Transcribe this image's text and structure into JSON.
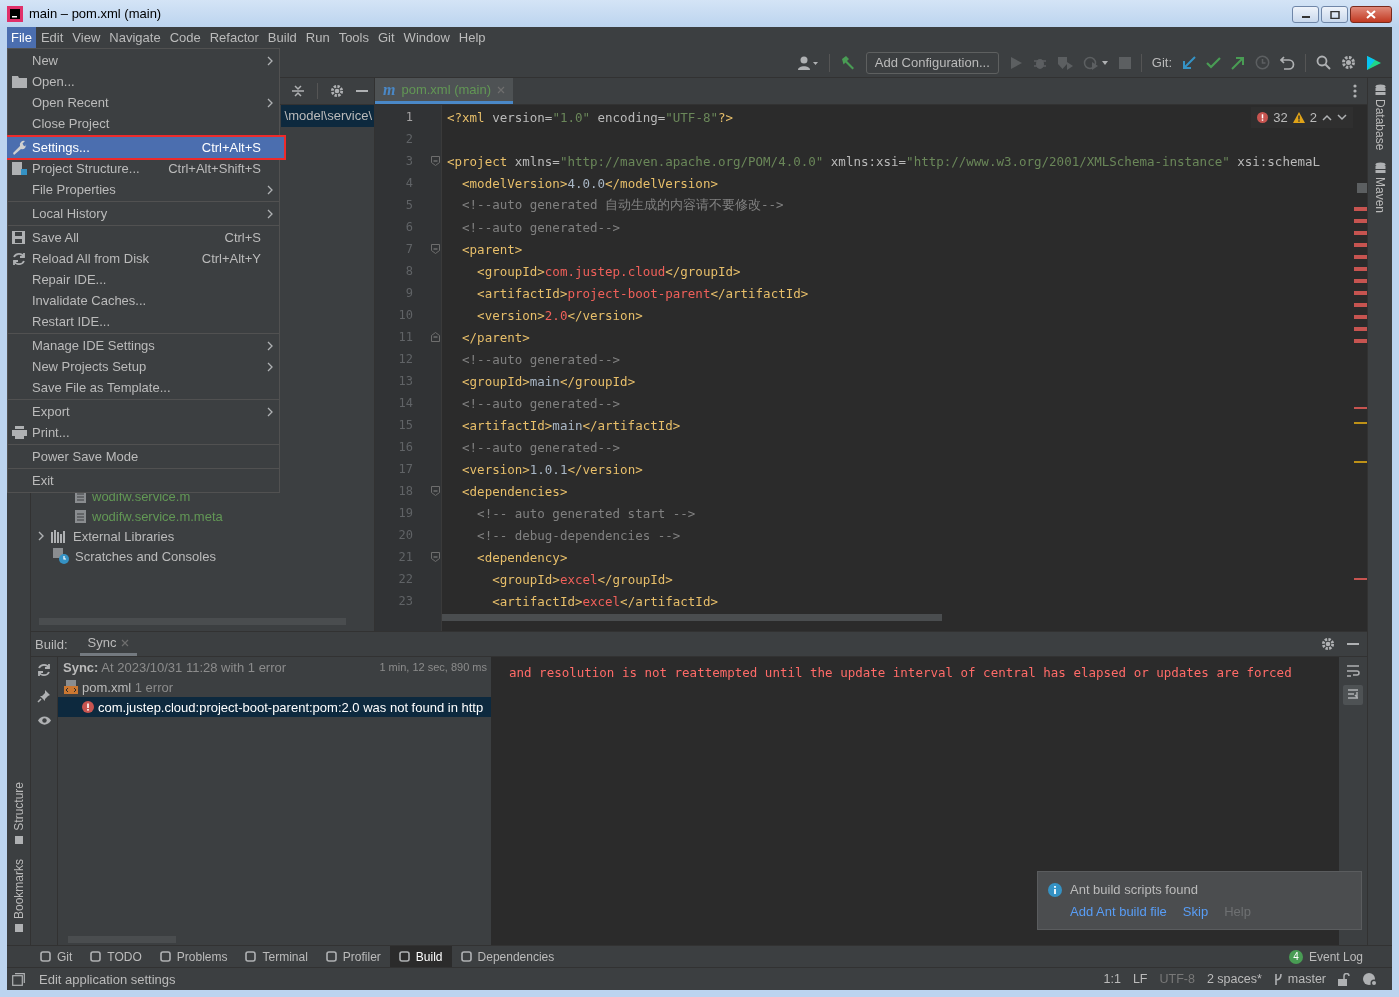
{
  "window": {
    "title": "main – pom.xml (main)"
  },
  "menu_bar": [
    {
      "label": "File",
      "selected": true
    },
    {
      "label": "Edit",
      "selected": false
    },
    {
      "label": "View",
      "selected": false
    },
    {
      "label": "Navigate",
      "selected": false
    },
    {
      "label": "Code",
      "selected": false
    },
    {
      "label": "Refactor",
      "selected": false
    },
    {
      "label": "Build",
      "selected": false
    },
    {
      "label": "Run",
      "selected": false
    },
    {
      "label": "Tools",
      "selected": false
    },
    {
      "label": "Git",
      "selected": false
    },
    {
      "label": "Window",
      "selected": false
    },
    {
      "label": "Help",
      "selected": false
    }
  ],
  "file_menu": [
    {
      "label": "New",
      "submenu": true,
      "selected": false
    },
    {
      "label": "Open...",
      "kind": "folder",
      "selected": false
    },
    {
      "label": "Open Recent",
      "submenu": true,
      "selected": false
    },
    {
      "label": "Close Project",
      "selected": false
    },
    {
      "label": "Settings...",
      "shortcut": "Ctrl+Alt+S",
      "kind": "wrench",
      "separator_before": true,
      "selected": true,
      "outlined": true
    },
    {
      "label": "Project Structure...",
      "shortcut": "Ctrl+Alt+Shift+S",
      "kind": "structure",
      "selected": false
    },
    {
      "label": "File Properties",
      "submenu": true,
      "selected": false
    },
    {
      "label": "Local History",
      "submenu": true,
      "separator_before": true,
      "selected": false
    },
    {
      "label": "Save All",
      "shortcut": "Ctrl+S",
      "kind": "save",
      "separator_before": true,
      "selected": false
    },
    {
      "label": "Reload All from Disk",
      "shortcut": "Ctrl+Alt+Y",
      "kind": "reload",
      "selected": false
    },
    {
      "label": "Repair IDE...",
      "selected": false
    },
    {
      "label": "Invalidate Caches...",
      "selected": false
    },
    {
      "label": "Restart IDE...",
      "selected": false
    },
    {
      "label": "Manage IDE Settings",
      "submenu": true,
      "separator_before": true,
      "selected": false
    },
    {
      "label": "New Projects Setup",
      "submenu": true,
      "selected": false
    },
    {
      "label": "Save File as Template...",
      "selected": false
    },
    {
      "label": "Export",
      "submenu": true,
      "separator_before": true,
      "selected": false
    },
    {
      "label": "Print...",
      "kind": "print",
      "selected": false
    },
    {
      "label": "Power Save Mode",
      "separator_before": true,
      "selected": false
    },
    {
      "label": "Exit",
      "separator_before": true,
      "selected": false
    }
  ],
  "toolbar": {
    "run_configuration": "Add Configuration...",
    "git_label": "Git:"
  },
  "left_strip": [
    "Structure",
    "Bookmarks"
  ],
  "right_strip": [
    "Database",
    "Maven"
  ],
  "project_panel": {
    "breadcrumb": "\\model\\service\\",
    "tree": [
      {
        "label": "wodifw.service.m",
        "kind": "file",
        "color": "#629755"
      },
      {
        "label": "wodifw.service.m.meta",
        "kind": "file",
        "color": "#629755"
      },
      {
        "label": "External Libraries",
        "kind": "libraries",
        "expanded": false,
        "color": "#bbbbbb"
      },
      {
        "label": "Scratches and Consoles",
        "kind": "scratches",
        "color": "#bbbbbb"
      }
    ]
  },
  "editor": {
    "tab": {
      "file_type_letter": "m",
      "label": "pom.xml (main)",
      "selected": true
    },
    "errors": "32",
    "warnings": "2",
    "lines": [
      {
        "number": "1",
        "current": true,
        "tokens": [
          {
            "kind": "tag",
            "text": "<?xml"
          },
          {
            "kind": "attr",
            "text": " version="
          },
          {
            "kind": "value",
            "text": "\"1.0\""
          },
          {
            "kind": "attr",
            "text": " encoding="
          },
          {
            "kind": "value",
            "text": "\"UTF-8\""
          },
          {
            "kind": "tag",
            "text": "?>"
          }
        ]
      },
      {
        "number": "2",
        "current": false
      },
      {
        "number": "3",
        "current": false,
        "kind": "fold_start",
        "tokens": [
          {
            "kind": "tag",
            "text": "<project"
          },
          {
            "kind": "attr",
            "text": " xmlns="
          },
          {
            "kind": "value",
            "text": "\"http://maven.apache.org/POM/4.0.0\""
          },
          {
            "kind": "attr",
            "text": " xmlns:xsi="
          },
          {
            "kind": "value",
            "text": "\"http://www.w3.org/2001/XMLSchema-instance\""
          },
          {
            "kind": "attr",
            "text": " xsi:schemaL"
          }
        ]
      },
      {
        "number": "4",
        "current": false,
        "tokens": [
          {
            "kind": "tag",
            "text": "  <modelVersion>"
          },
          {
            "kind": "text",
            "text": "4.0.0"
          },
          {
            "kind": "tag",
            "text": "</modelVersion>"
          }
        ]
      },
      {
        "number": "5",
        "current": false,
        "tokens": [
          {
            "kind": "comment",
            "text": "  <!--auto generated 自动生成的内容请不要修改-->"
          }
        ]
      },
      {
        "number": "6",
        "current": false,
        "tokens": [
          {
            "kind": "comment",
            "text": "  <!--auto generated-->"
          }
        ]
      },
      {
        "number": "7",
        "current": false,
        "kind": "fold_start",
        "tokens": [
          {
            "kind": "tag",
            "text": "  <parent>"
          }
        ]
      },
      {
        "number": "8",
        "current": false,
        "tokens": [
          {
            "kind": "tag",
            "text": "    <groupId>"
          },
          {
            "kind": "error",
            "text": "com.justep.cloud"
          },
          {
            "kind": "tag",
            "text": "</groupId>"
          }
        ]
      },
      {
        "number": "9",
        "current": false,
        "tokens": [
          {
            "kind": "tag",
            "text": "    <artifactId>"
          },
          {
            "kind": "error",
            "text": "project-boot-parent"
          },
          {
            "kind": "tag",
            "text": "</artifactId>"
          }
        ]
      },
      {
        "number": "10",
        "current": false,
        "tokens": [
          {
            "kind": "tag",
            "text": "    <version>"
          },
          {
            "kind": "error",
            "text": "2.0"
          },
          {
            "kind": "tag",
            "text": "</version>"
          }
        ]
      },
      {
        "number": "11",
        "current": false,
        "kind": "fold_end",
        "tokens": [
          {
            "kind": "tag",
            "text": "  </parent>"
          }
        ]
      },
      {
        "number": "12",
        "current": false,
        "tokens": [
          {
            "kind": "comment",
            "text": "  <!--auto generated-->"
          }
        ]
      },
      {
        "number": "13",
        "current": false,
        "tokens": [
          {
            "kind": "tag",
            "text": "  <groupId>"
          },
          {
            "kind": "text",
            "text": "main"
          },
          {
            "kind": "tag",
            "text": "</groupId>"
          }
        ]
      },
      {
        "number": "14",
        "current": false,
        "tokens": [
          {
            "kind": "comment",
            "text": "  <!--auto generated-->"
          }
        ]
      },
      {
        "number": "15",
        "current": false,
        "tokens": [
          {
            "kind": "tag",
            "text": "  <artifactId>"
          },
          {
            "kind": "text",
            "text": "main"
          },
          {
            "kind": "tag",
            "text": "</artifactId>"
          }
        ]
      },
      {
        "number": "16",
        "current": false,
        "tokens": [
          {
            "kind": "comment",
            "text": "  <!--auto generated-->"
          }
        ]
      },
      {
        "number": "17",
        "current": false,
        "tokens": [
          {
            "kind": "tag",
            "text": "  <version>"
          },
          {
            "kind": "text",
            "text": "1.0.1"
          },
          {
            "kind": "tag",
            "text": "</version>"
          }
        ]
      },
      {
        "number": "18",
        "current": false,
        "kind": "fold_start",
        "tokens": [
          {
            "kind": "tag",
            "text": "  <dependencies>"
          }
        ]
      },
      {
        "number": "19",
        "current": false,
        "tokens": [
          {
            "kind": "comment",
            "text": "    <!-- auto generated start -->"
          }
        ]
      },
      {
        "number": "20",
        "current": false,
        "tokens": [
          {
            "kind": "comment",
            "text": "    <!-- debug-dependencies -->"
          }
        ]
      },
      {
        "number": "21",
        "current": false,
        "kind": "fold_start",
        "tokens": [
          {
            "kind": "tag",
            "text": "    <dependency>"
          }
        ]
      },
      {
        "number": "22",
        "current": false,
        "tokens": [
          {
            "kind": "tag",
            "text": "      <groupId>"
          },
          {
            "kind": "error",
            "text": "excel"
          },
          {
            "kind": "tag",
            "text": "</groupId>"
          }
        ]
      },
      {
        "number": "23",
        "current": false,
        "tokens": [
          {
            "kind": "tag",
            "text": "      <artifactId>"
          },
          {
            "kind": "error",
            "text": "excel"
          },
          {
            "kind": "tag",
            "text": "</artifactId>"
          }
        ]
      }
    ]
  },
  "build_panel": {
    "label": "Build:",
    "tabs": [
      {
        "label": "Sync",
        "selected": true
      }
    ],
    "tree": [
      {
        "kind": "sync",
        "title": "Sync:",
        "text": "At 2023/10/31 11:28 with 1 error",
        "time": "1 min, 12 sec, 890 ms",
        "selected": false
      },
      {
        "kind": "file",
        "title": "pom.xml",
        "text": "1 error",
        "selected": false
      },
      {
        "kind": "error",
        "text": "com.justep.cloud:project-boot-parent:pom:2.0 was not found in http",
        "selected": true
      }
    ],
    "console": "and resolution is not reattempted until the update interval of central has elapsed or updates are forced"
  },
  "notification": {
    "title": "Ant build scripts found",
    "actions": [
      {
        "label": "Add Ant build file",
        "disabled": false
      },
      {
        "label": "Skip",
        "disabled": false
      },
      {
        "label": "Help",
        "disabled": true
      }
    ]
  },
  "tool_tabs": [
    {
      "label": "Git",
      "selected": false
    },
    {
      "label": "TODO",
      "selected": false
    },
    {
      "label": "Problems",
      "selected": false
    },
    {
      "label": "Terminal",
      "selected": false
    },
    {
      "label": "Profiler",
      "selected": false
    },
    {
      "label": "Build",
      "selected": true
    },
    {
      "label": "Dependencies",
      "selected": false
    }
  ],
  "event_log": {
    "label": "Event Log",
    "count": "4"
  },
  "status_bar": {
    "message": "Edit application settings",
    "position": "1:1",
    "line_separator": "LF",
    "encoding": "UTF-8",
    "indent": "2 spaces*",
    "branch": "master"
  }
}
